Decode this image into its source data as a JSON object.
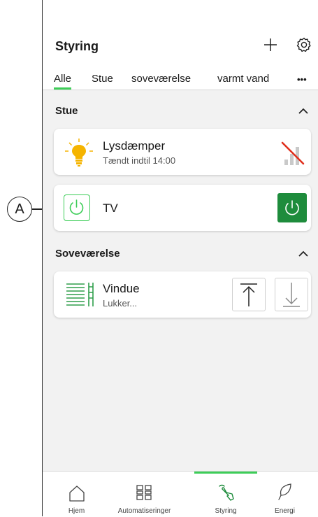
{
  "header": {
    "title": "Styring",
    "add_icon": "plus-icon",
    "settings_icon": "gear-icon"
  },
  "tabs": [
    {
      "label": "Alle",
      "active": true
    },
    {
      "label": "Stue"
    },
    {
      "label": "soveværelse"
    },
    {
      "label": "varmt vand"
    },
    {
      "label": "•••"
    }
  ],
  "sections": {
    "stue": {
      "title": "Stue",
      "devices": {
        "light": {
          "name": "Lysdæmper",
          "status": "Tændt indtil 14:00",
          "icon": "light-bulb-icon",
          "control_icon": "brightness-off-icon"
        },
        "tv": {
          "name": "TV",
          "icon": "power-icon",
          "toggle_icon": "power-toggle-icon"
        }
      }
    },
    "sovevaerelse": {
      "title": "Soveværelse",
      "devices": {
        "blind": {
          "name": "Vindue",
          "status": "Lukker...",
          "icon": "blinds-icon",
          "up_icon": "arrow-up-icon",
          "down_icon": "arrow-down-icon"
        }
      }
    }
  },
  "callout": {
    "label": "A"
  },
  "bottom_nav": [
    {
      "label": "Hjem",
      "icon": "home-icon"
    },
    {
      "label": "Automatiseringer",
      "icon": "grid-icon"
    },
    {
      "label": "Styring",
      "icon": "touch-hand-icon",
      "active": true
    },
    {
      "label": "Energi",
      "icon": "leaf-icon"
    }
  ],
  "colors": {
    "accent": "#3dcd58",
    "accent_dark": "#1e8c3c",
    "bulb": "#f5b400",
    "off_red": "#e0301e"
  }
}
